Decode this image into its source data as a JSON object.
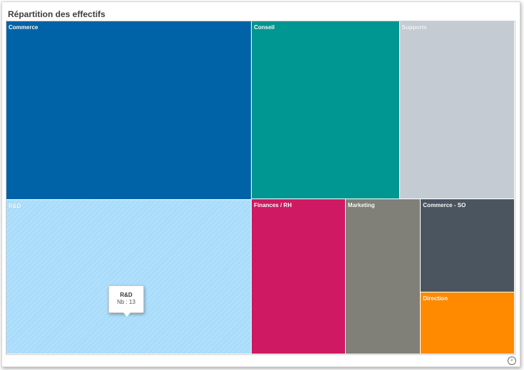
{
  "header": {
    "title": "Répartition des effectifs"
  },
  "tooltip": {
    "name": "R&D",
    "value_text": "Nb : 13"
  },
  "chart_data": {
    "type": "treemap",
    "title": "Répartition des effectifs",
    "items": [
      {
        "name": "Commerce",
        "value": 15,
        "color": "#0063a8"
      },
      {
        "name": "R&D",
        "value": 13,
        "color": "#a8dcfa"
      },
      {
        "name": "Conseil",
        "value": 9,
        "color": "#009691"
      },
      {
        "name": "Supports",
        "value": 7,
        "color": "#c4cbd3"
      },
      {
        "name": "Finances / RH",
        "value": 5,
        "color": "#cf1a63"
      },
      {
        "name": "Marketing",
        "value": 4,
        "color": "#808079"
      },
      {
        "name": "Commerce - SO",
        "value": 3,
        "color": "#4a5560"
      },
      {
        "name": "Direction",
        "value": 2,
        "color": "#ff8a00"
      }
    ],
    "hovered": "R&D"
  },
  "icons": {
    "zoom": "zoom-icon"
  }
}
